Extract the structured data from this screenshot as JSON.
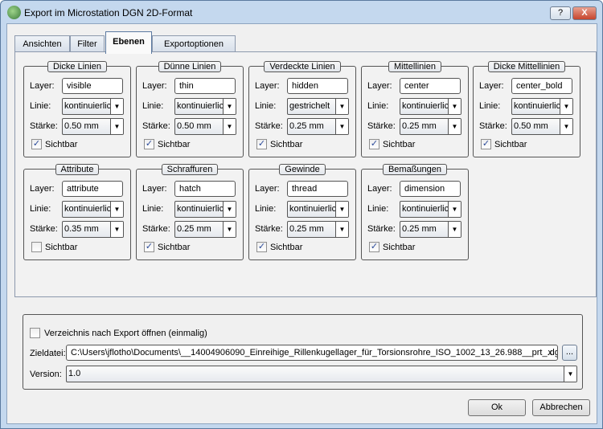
{
  "window": {
    "title": "Export im Microstation DGN 2D-Format",
    "help_label": "?",
    "close_label": "X"
  },
  "tabs": [
    {
      "label": "Ansichten"
    },
    {
      "label": "Filter"
    },
    {
      "label": "Ebenen"
    },
    {
      "label": "Exportoptionen"
    }
  ],
  "labels": {
    "layer": "Layer:",
    "linie": "Linie:",
    "staerke": "Stärke:",
    "sichtbar": "Sichtbar"
  },
  "groups": [
    {
      "title": "Dicke Linien",
      "layer": "visible",
      "linie": "kontinuierlich",
      "staerke": "0.50 mm",
      "sichtbar": true
    },
    {
      "title": "Dünne Linien",
      "layer": "thin",
      "linie": "kontinuierlich",
      "staerke": "0.50 mm",
      "sichtbar": true
    },
    {
      "title": "Verdeckte Linien",
      "layer": "hidden",
      "linie": "gestrichelt",
      "staerke": "0.25 mm",
      "sichtbar": true
    },
    {
      "title": "Mittellinien",
      "layer": "center",
      "linie": "kontinuierlich",
      "staerke": "0.25 mm",
      "sichtbar": true
    },
    {
      "title": "Dicke Mittellinien",
      "layer": "center_bold",
      "linie": "kontinuierlich",
      "staerke": "0.50 mm",
      "sichtbar": true
    },
    {
      "title": "Attribute",
      "layer": "attribute",
      "linie": "kontinuierlich",
      "staerke": "0.35 mm",
      "sichtbar": false
    },
    {
      "title": "Schraffuren",
      "layer": "hatch",
      "linie": "kontinuierlich",
      "staerke": "0.25 mm",
      "sichtbar": true
    },
    {
      "title": "Gewinde",
      "layer": "thread",
      "linie": "kontinuierlich",
      "staerke": "0.25 mm",
      "sichtbar": true
    },
    {
      "title": "Bemaßungen",
      "layer": "dimension",
      "linie": "kontinuierlich",
      "staerke": "0.25 mm",
      "sichtbar": true
    }
  ],
  "bottom": {
    "open_dir_label": "Verzeichnis nach Export öffnen (einmalig)",
    "open_dir_checked": false,
    "zieldatei_label": "Zieldatei:",
    "zieldatei_value": "C:\\Users\\jflotho\\Documents\\__14004906090_Einreihige_Rillenkugellager_für_Torsionsrohre_ISO_1002_13_26.988__prt_.dgn",
    "clear_label": "x",
    "browse_label": "...",
    "version_label": "Version:",
    "version_value": "1.0"
  },
  "buttons": {
    "ok": "Ok",
    "cancel": "Abbrechen"
  }
}
